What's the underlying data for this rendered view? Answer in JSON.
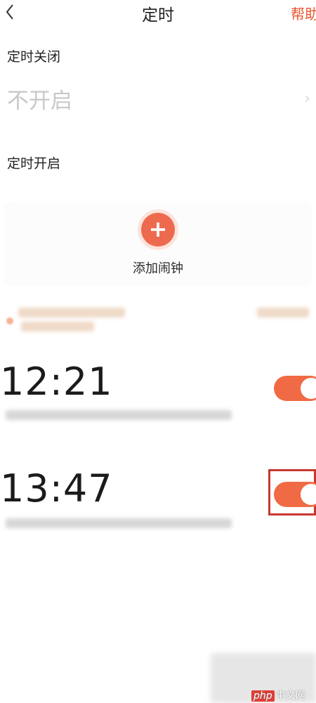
{
  "header": {
    "title": "定时",
    "help_label": "帮助"
  },
  "timer_off": {
    "label": "定时关闭",
    "value": "不开启"
  },
  "timer_on": {
    "label": "定时开启"
  },
  "add_alarm": {
    "label": "添加闹钟"
  },
  "alarms": [
    {
      "time": "12:21",
      "enabled": true
    },
    {
      "time": "13:47",
      "enabled": true
    }
  ],
  "watermark": {
    "badge": "php",
    "text": "中文网"
  },
  "colors": {
    "accent": "#f06a45",
    "highlight": "#c8382f"
  }
}
